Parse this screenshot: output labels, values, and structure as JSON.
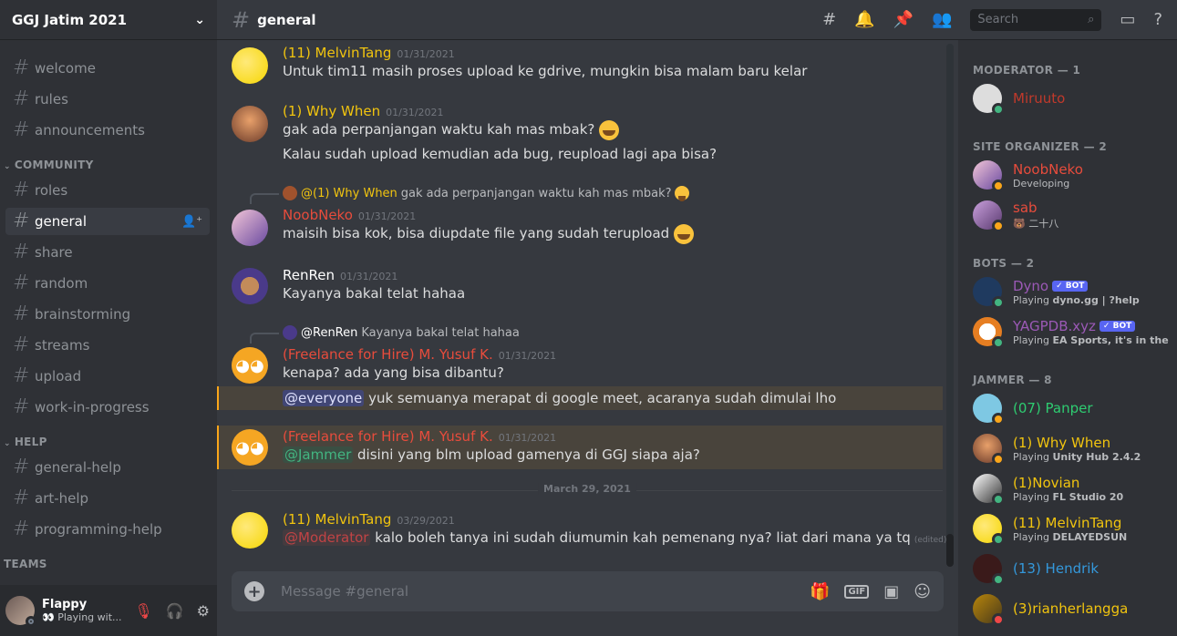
{
  "server": {
    "name": "GGJ Jatim 2021"
  },
  "channels": {
    "top": [
      "welcome",
      "rules",
      "announcements"
    ],
    "community_label": "COMMUNITY",
    "community": [
      "roles",
      "general",
      "share",
      "random",
      "brainstorming",
      "streams",
      "upload",
      "work-in-progress"
    ],
    "help_label": "HELP",
    "help": [
      "general-help",
      "art-help",
      "programming-help"
    ],
    "teams_label": "TEAMS",
    "active": "general"
  },
  "user": {
    "name": "Flappy",
    "status": "👀 Playing wit..."
  },
  "header": {
    "channel": "general",
    "search_placeholder": "Search"
  },
  "messages": [
    {
      "author": "(11) MelvinTang",
      "time": "01/31/2021",
      "lines": [
        "Untuk tim11 masih proses upload ke gdrive, mungkin bisa malam baru kelar"
      ],
      "color": "#f1c40f"
    },
    {
      "author": "(1) Why When",
      "time": "01/31/2021",
      "lines": [
        "gak ada perpanjangan waktu kah mas mbak?",
        "Kalau sudah upload kemudian ada bug, reupload lagi apa bisa?"
      ],
      "color": "#f1c40f"
    },
    {
      "reply_author": "@(1) Why When",
      "reply_text": "gak ada perpanjangan waktu kah mas mbak?",
      "author": "NoobNeko",
      "time": "01/31/2021",
      "lines": [
        "maisih bisa kok, bisa diupdate file yang sudah terupload"
      ],
      "color": "#e74c3c"
    },
    {
      "author": "RenRen",
      "time": "01/31/2021",
      "lines": [
        "Kayanya bakal telat hahaa"
      ],
      "color": "#ffffff"
    },
    {
      "reply_author": "@RenRen",
      "reply_text": "Kayanya bakal telat hahaa",
      "author": "(Freelance for Hire) M. Yusuf K.",
      "time": "01/31/2021",
      "lines": [
        "kenapa? ada yang bisa dibantu?"
      ],
      "mention_everyone": "@everyone",
      "everyone_text": " yuk semuanya merapat di google meet, acaranya sudah dimulai lho",
      "color": "#e74c3c"
    },
    {
      "author": "(Freelance for Hire) M. Yusuf K.",
      "time": "01/31/2021",
      "mention": "@Jammer",
      "text": " disini yang blm upload gamenya di GGJ siapa aja?",
      "color": "#e74c3c"
    },
    {
      "author": "(11) MelvinTang",
      "time": "03/29/2021",
      "mention": "@Moderator",
      "text": " kalo boleh tanya ini sudah diumumin kah pemenang nya? liat dari mana ya tq",
      "edited": "(edited)",
      "color": "#f1c40f"
    }
  ],
  "date_divider": "March 29, 2021",
  "composer": {
    "placeholder": "Message #general",
    "gif": "GIF"
  },
  "members": {
    "moderator_label": "MODERATOR — 1",
    "site_organizer_label": "SITE ORGANIZER — 2",
    "bots_label": "BOTS — 2",
    "jammer_label": "JAMMER — 8",
    "list": [
      {
        "name": "Miruuto",
        "status": "",
        "color": "#c0392b"
      },
      {
        "name": "NoobNeko",
        "status": "Developing",
        "color": "#e74c3c"
      },
      {
        "name": "sab",
        "status": "🐻 二十八",
        "color": "#e74c3c"
      },
      {
        "name": "Dyno",
        "status_prefix": "Playing ",
        "status": "dyno.gg | ?help",
        "bot": "✓ BOT",
        "color": "#9b59b6"
      },
      {
        "name": "YAGPDB.xyz",
        "status_prefix": "Playing ",
        "status": "EA Sports, it's in the g...",
        "bot": "✓ BOT",
        "color": "#9b59b6"
      },
      {
        "name": "(07) Panper",
        "status": "",
        "color": "#2ecc71"
      },
      {
        "name": "(1) Why When",
        "status_prefix": "Playing ",
        "status": "Unity Hub 2.4.2",
        "color": "#f1c40f"
      },
      {
        "name": "(1)Novian",
        "status_prefix": "Playing ",
        "status": "FL Studio 20",
        "color": "#f1c40f"
      },
      {
        "name": "(11) MelvinTang",
        "status_prefix": "Playing ",
        "status": "DELAYEDSUN",
        "color": "#f1c40f"
      },
      {
        "name": "(13) Hendrik",
        "status": "",
        "color": "#3498db"
      },
      {
        "name": "(3)rianherlangga",
        "status": "",
        "color": "#f1c40f"
      }
    ]
  }
}
